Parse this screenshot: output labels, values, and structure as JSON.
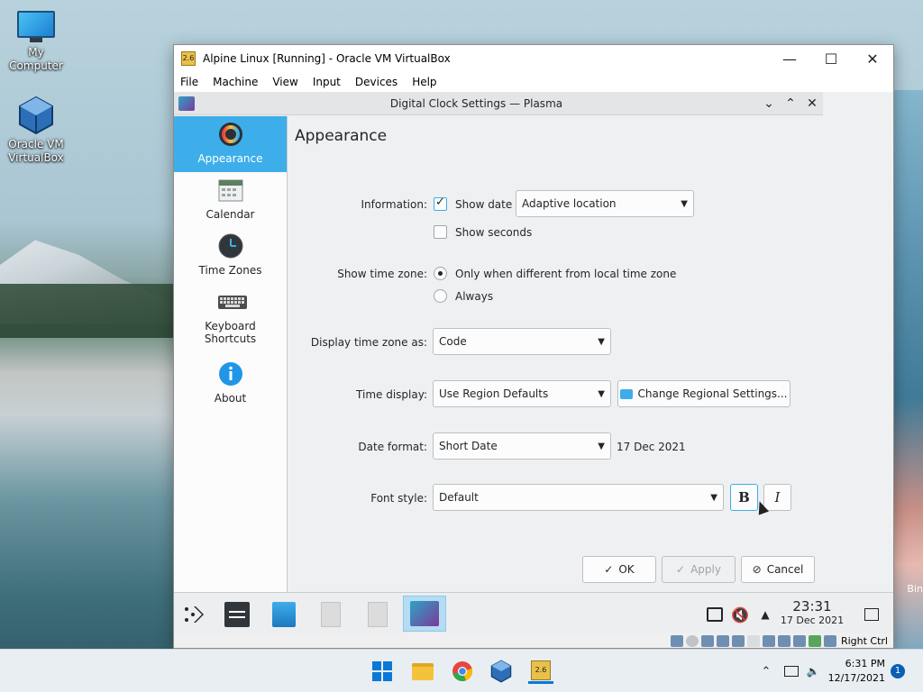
{
  "desktop": {
    "icons": [
      {
        "label": "My Computer",
        "icon": "monitor-icon"
      },
      {
        "label": "Oracle VM VirtualBox",
        "icon": "virtualbox-icon"
      }
    ],
    "recycle_hint": "Bin"
  },
  "vm_window": {
    "title": "Alpine Linux [Running] - Oracle VM VirtualBox",
    "app_badge": "2.6",
    "controls": [
      "—",
      "☐",
      "✕"
    ],
    "menu": [
      "File",
      "Machine",
      "View",
      "Input",
      "Devices",
      "Help"
    ],
    "status_host_key": "Right Ctrl"
  },
  "dialog": {
    "title": "Digital Clock Settings — Plasma",
    "controls": [
      "⌄",
      "⌃",
      "✕"
    ],
    "sidebar": [
      {
        "label": "Appearance",
        "icon": "appearance-icon",
        "active": true
      },
      {
        "label": "Calendar",
        "icon": "calendar-icon"
      },
      {
        "label": "Time Zones",
        "icon": "clock-icon"
      },
      {
        "label": "Keyboard\nShortcuts",
        "label_line1": "Keyboard",
        "label_line2": "Shortcuts",
        "icon": "keyboard-icon"
      },
      {
        "label": "About",
        "icon": "info-icon"
      }
    ],
    "page_title": "Appearance",
    "information_label": "Information:",
    "show_date_label": "Show date",
    "show_date_checked": true,
    "date_location_value": "Adaptive location",
    "show_seconds_label": "Show seconds",
    "show_seconds_checked": false,
    "show_time_zone_label": "Show time zone:",
    "tz_option_1": "Only when different from local time zone",
    "tz_option_2": "Always",
    "tz_selected": 1,
    "display_tz_label": "Display time zone as:",
    "display_tz_value": "Code",
    "time_display_label": "Time display:",
    "time_display_value": "Use Region Defaults",
    "change_regional_label": "Change Regional Settings...",
    "date_format_label": "Date format:",
    "date_format_value": "Short Date",
    "date_preview": "17 Dec 2021",
    "font_style_label": "Font style:",
    "font_style_value": "Default",
    "bold_label": "B",
    "italic_label": "I",
    "ok_label": "OK",
    "apply_label": "Apply",
    "cancel_label": "Cancel"
  },
  "kde_panel": {
    "time": "23:31",
    "date": "17 Dec 2021"
  },
  "windows_taskbar": {
    "time": "6:31 PM",
    "date": "12/17/2021",
    "notifications": "1"
  }
}
